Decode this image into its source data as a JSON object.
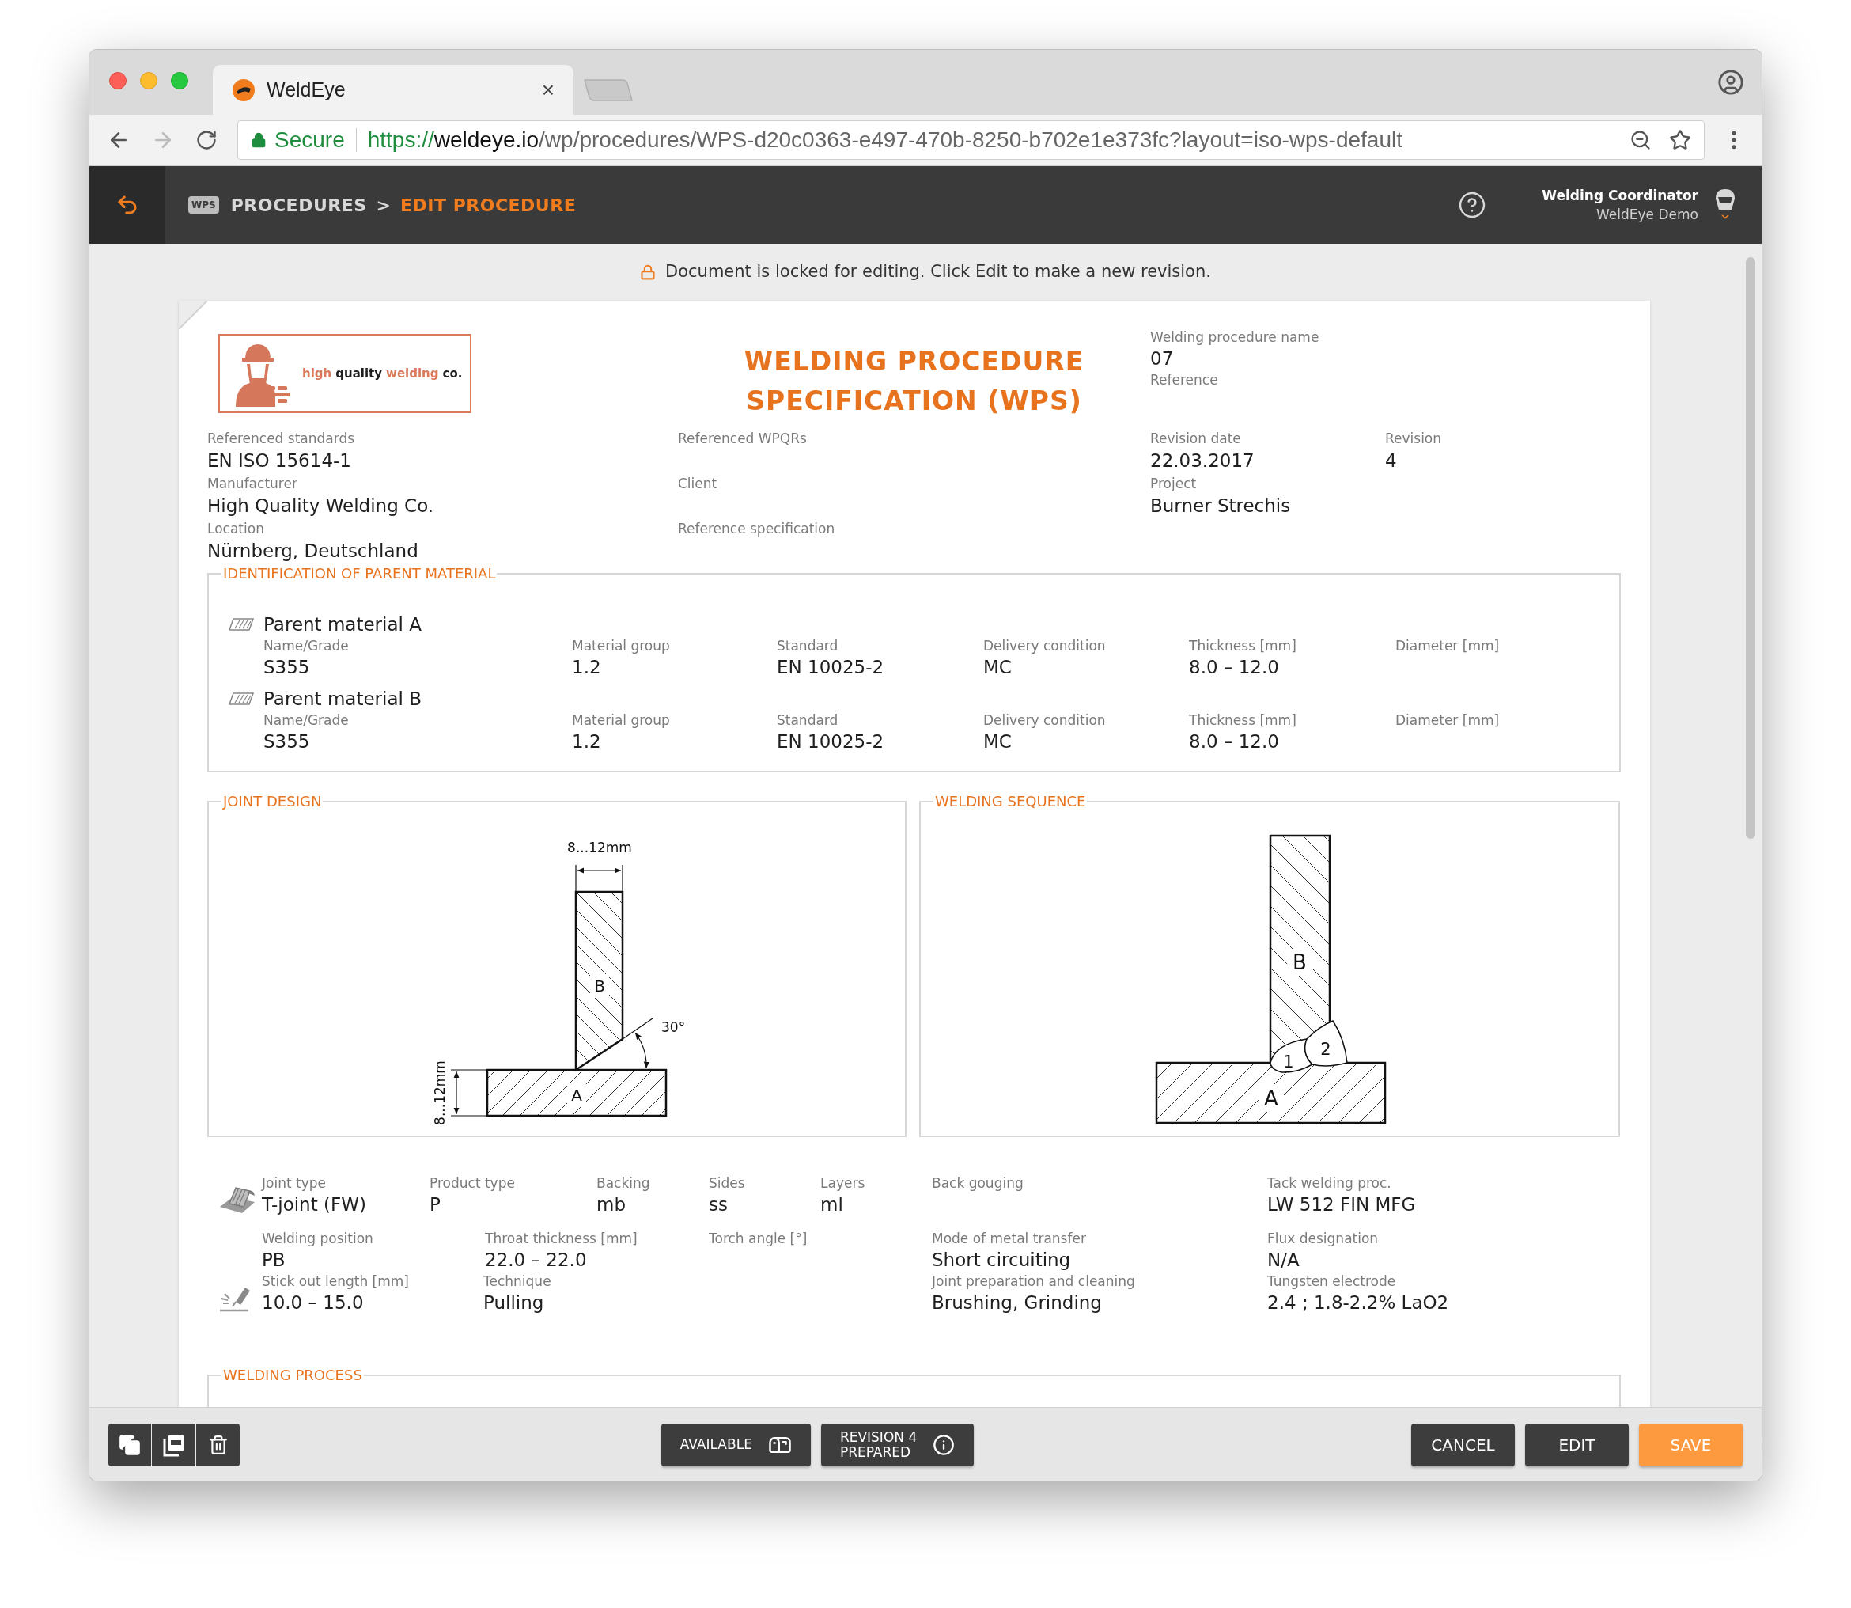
{
  "browser": {
    "tab": {
      "title": "WeldEye",
      "close": "×"
    },
    "secure_label": "Secure",
    "url": {
      "scheme": "https://",
      "host": "weldeye.io",
      "path": "/wp/procedures/WPS-d20c0363-e497-470b-8250-b702e1e373fc?layout=iso-wps-default"
    }
  },
  "header": {
    "badge": "WPS",
    "breadcrumb": [
      {
        "label": "PROCEDURES",
        "selected": false
      },
      {
        "label": "EDIT PROCEDURE",
        "selected": true
      }
    ],
    "separator": ">",
    "user": {
      "role": "Welding Coordinator",
      "org": "WeldEye Demo"
    }
  },
  "notice": "Document is locked for editing. Click Edit to make a new revision.",
  "document": {
    "logo": [
      {
        "text": "high",
        "color": "#d97a5a"
      },
      {
        "text": "quality",
        "color": "#1f1f1f"
      },
      {
        "text": "welding",
        "color": "#d97a5a"
      },
      {
        "text": "co.",
        "color": "#1f1f1f"
      }
    ],
    "title": [
      "WELDING PROCEDURE",
      "SPECIFICATION (WPS)"
    ],
    "name_fields": [
      {
        "label": "Welding procedure name",
        "value": "07"
      },
      {
        "label": "Reference"
      }
    ],
    "columns": [
      [
        {
          "label": "Referenced standards",
          "value": "EN ISO 15614-1"
        },
        {
          "label": "Manufacturer",
          "value": "High Quality Welding Co."
        },
        {
          "label": "Location",
          "value": "Nürnberg, Deutschland"
        }
      ],
      [
        {
          "label": "Referenced WPQRs"
        },
        {
          "label": "Client"
        },
        {
          "label": "Reference specification"
        }
      ],
      [
        {
          "label": "Revision date",
          "value": "22.03.2017"
        },
        {
          "label": "Project",
          "value": "Burner Strechis"
        }
      ],
      [
        {
          "label": "Revision",
          "value": "4"
        }
      ]
    ],
    "parent_material": {
      "legend": "IDENTIFICATION OF PARENT MATERIAL",
      "materials": [
        {
          "title": "Parent material A",
          "fields": [
            {
              "label": "Name/Grade",
              "value": "S355"
            },
            {
              "label": "Material group",
              "value": "1.2"
            },
            {
              "label": "Standard",
              "value": "EN 10025-2"
            },
            {
              "label": "Delivery condition",
              "value": "MC"
            },
            {
              "label": "Thickness [mm]",
              "value": "8.0 – 12.0"
            },
            {
              "label": "Diameter [mm]"
            }
          ]
        },
        {
          "title": "Parent material B",
          "fields": [
            {
              "label": "Name/Grade",
              "value": "S355"
            },
            {
              "label": "Material group",
              "value": "1.2"
            },
            {
              "label": "Standard",
              "value": "EN 10025-2"
            },
            {
              "label": "Delivery condition",
              "value": "MC"
            },
            {
              "label": "Thickness [mm]",
              "value": "8.0 – 12.0"
            },
            {
              "label": "Diameter [mm]"
            }
          ]
        }
      ]
    },
    "joint_design": {
      "legend": "JOINT DESIGN",
      "width_label": "8...12mm",
      "thickness_label": "8...12mm",
      "angle_label": "30°",
      "plate_labels": [
        "B",
        "A"
      ]
    },
    "welding_sequence": {
      "legend": "WELDING SEQUENCE",
      "plate_labels": [
        "B",
        "A"
      ],
      "pass_labels": [
        "1",
        "2"
      ]
    },
    "details": [
      {
        "kind": "joint",
        "fields": [
          {
            "label": "Joint type",
            "value": "T-joint (FW)"
          },
          {
            "label": "Product type",
            "value": "P"
          },
          {
            "label": "Backing",
            "value": "mb"
          },
          {
            "label": "Sides",
            "value": "ss"
          },
          {
            "label": "Layers",
            "value": "ml"
          },
          {
            "label": "Back gouging"
          },
          {
            "label": "Tack welding proc.",
            "value": "LW 512 FIN MFG"
          }
        ]
      },
      {
        "kind": "plain",
        "fields": [
          {
            "label": "Welding position",
            "value": "PB"
          },
          {
            "label": "Throat thickness [mm]",
            "value": "22.0 – 22.0"
          },
          {
            "label": "Torch angle [°]"
          },
          {
            "label": "Mode of metal transfer",
            "value": "Short circuiting"
          },
          {
            "label": "Flux designation",
            "value": "N/A"
          }
        ]
      },
      {
        "kind": "stickout",
        "fields": [
          {
            "label": "Stick out length [mm]",
            "value": "10.0 – 15.0"
          },
          {
            "label": "Technique",
            "value": "Pulling"
          },
          {
            "label": "Joint preparation and cleaning",
            "value": "Brushing, Grinding"
          },
          {
            "label": "Tungsten electrode",
            "value": "2.4 ; 1.8-2.2% LaO2"
          }
        ]
      }
    ],
    "welding_process": {
      "legend": "WELDING PROCESS"
    }
  },
  "toolbar": {
    "status": [
      {
        "kind": "available",
        "lines": [
          "AVAILABLE"
        ]
      },
      {
        "kind": "revision",
        "lines": [
          "REVISION 4",
          "PREPARED"
        ]
      }
    ],
    "actions": [
      {
        "label": "CANCEL",
        "kind": "secondary"
      },
      {
        "label": "EDIT",
        "kind": "secondary"
      },
      {
        "label": "SAVE",
        "kind": "primary"
      }
    ]
  }
}
